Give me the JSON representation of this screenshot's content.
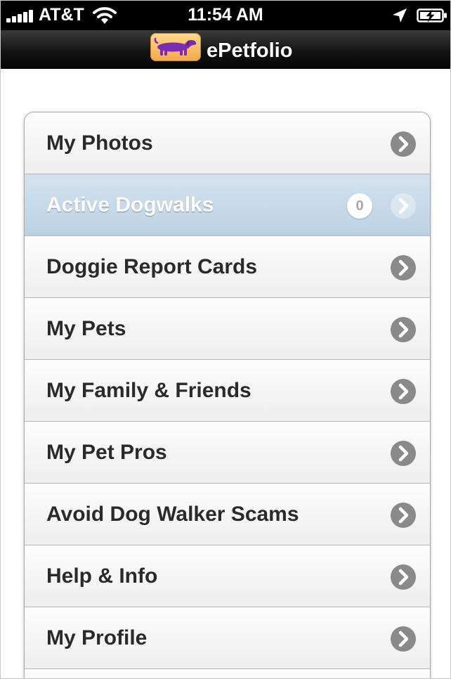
{
  "status_bar": {
    "carrier": "AT&T",
    "time": "11:54 AM",
    "signal_bars": 5,
    "icons": [
      "signal-icon",
      "wifi-icon",
      "location-arrow-icon",
      "battery-charging-icon"
    ]
  },
  "nav_bar": {
    "title": "ePetfolio",
    "logo_icon": "dachshund-logo-icon"
  },
  "menu": {
    "items": [
      {
        "label": "My Photos"
      },
      {
        "label": "Active Dogwalks",
        "badge": "0",
        "selected": true
      },
      {
        "label": "Doggie Report Cards"
      },
      {
        "label": "My Pets"
      },
      {
        "label": "My Family & Friends"
      },
      {
        "label": "My Pet Pros"
      },
      {
        "label": "Avoid Dog Walker Scams"
      },
      {
        "label": "Help & Info"
      },
      {
        "label": "My Profile"
      }
    ],
    "chevron_icon": "chevron-right-icon"
  },
  "colors": {
    "selected_row": "#c8dbea",
    "nav_bar": "#111111",
    "chevron": "#8a8a8a",
    "logo_background": "#f5b65a",
    "logo_dog": "#7b2bb5"
  }
}
